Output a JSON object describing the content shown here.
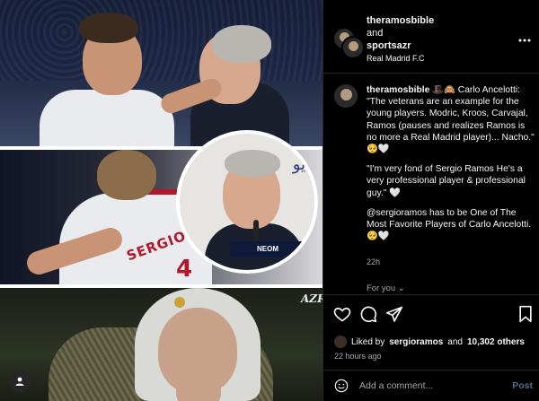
{
  "header": {
    "user_one": "theramosbible",
    "joiner": "and",
    "user_two": "sportsazr",
    "location": "Real Madrid F.C",
    "more_icon": "more-horizontal-icon"
  },
  "media": {
    "jersey_name": "SERGIO RAM",
    "jersey_number": "4",
    "sponsor": "NEOM",
    "watermark": "AZR",
    "arabic_fragment": "يو"
  },
  "caption": {
    "username": "theramosbible",
    "lines": [
      "🎩🙈 Carlo Ancelotti: \"The veterans are an example for the young players. Modric, Kroos, Carvajal, Ramos (pauses and realizes Ramos is no more a Real Madrid player)... Nacho.\" 🥺🤍",
      "\"I'm very fond of Sergio Ramos He's a very professional player & professional guy.\" 🤍",
      "@sergioramos has to be One of The Most Favorite Players of Carlo Ancelotti. 🥺🤍"
    ],
    "time": "22h",
    "for_you": "For you ⌄"
  },
  "actions": {
    "like_icon": "heart-icon",
    "comment_icon": "comment-icon",
    "share_icon": "send-icon",
    "save_icon": "bookmark-icon",
    "liked_prefix": "Liked by",
    "liked_user": "sergioramos",
    "liked_joiner": "and",
    "liked_others": "10,302 others",
    "posted_ago": "22 hours ago"
  },
  "comment_box": {
    "emoji_icon": "emoji-icon",
    "placeholder": "Add a comment...",
    "post_label": "Post"
  },
  "colors": {
    "background": "#000000",
    "text": "#f5f5f5",
    "muted": "#a8a8a8",
    "post_button": "#4c6f8f",
    "divider": "#262626"
  }
}
